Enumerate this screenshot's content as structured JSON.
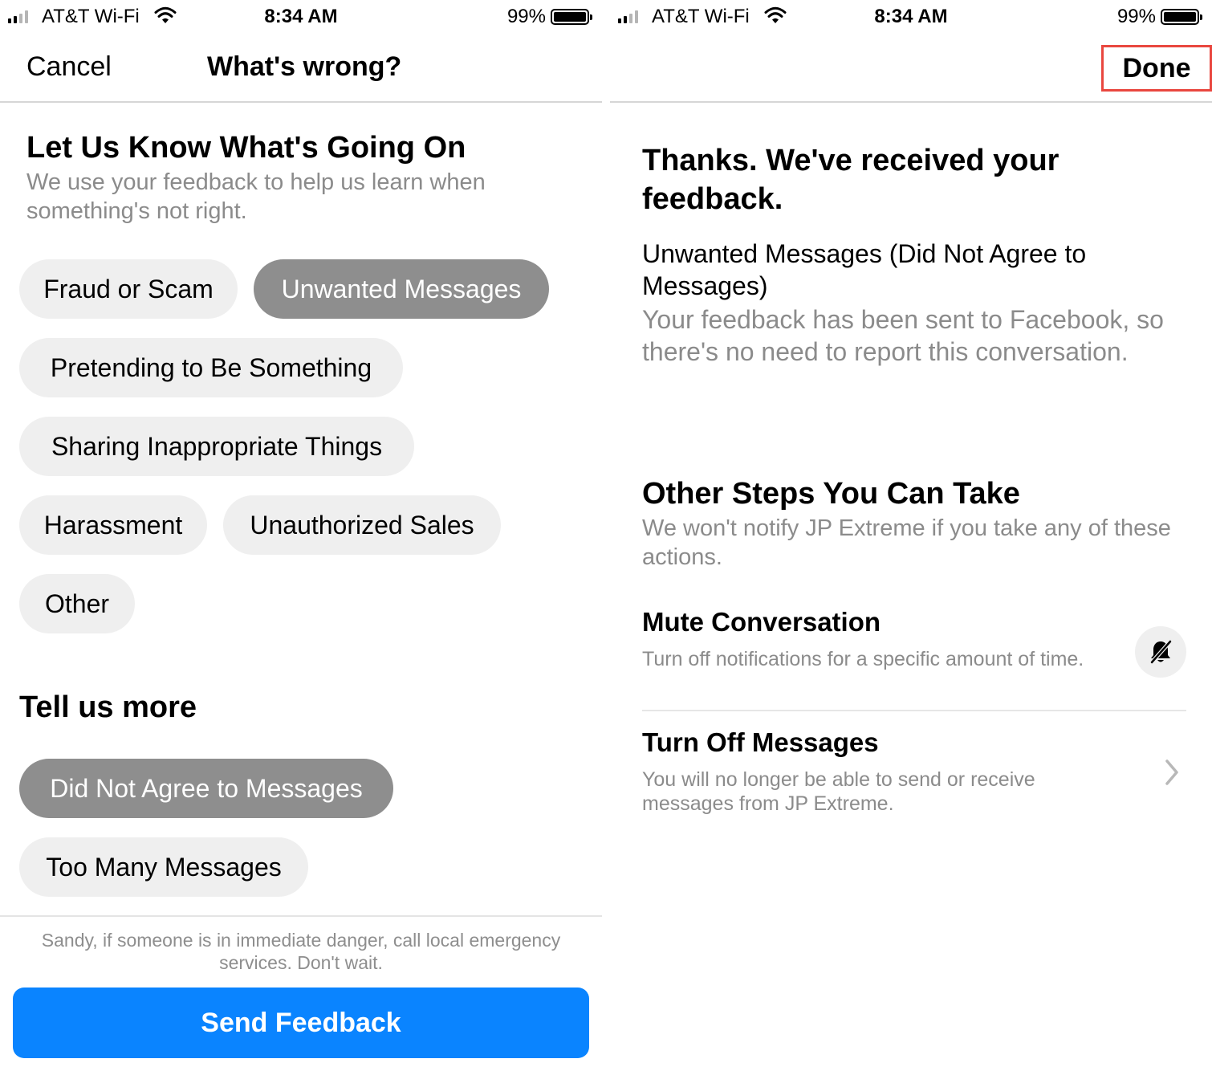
{
  "status_bar": {
    "carrier": "AT&T Wi-Fi",
    "time": "8:34 AM",
    "battery": "99%"
  },
  "left": {
    "nav": {
      "cancel_label": "Cancel",
      "title": "What's wrong?"
    },
    "heading": "Let Us Know What's Going On",
    "subheading": "We use your feedback to help us learn when something's not right.",
    "options": [
      {
        "label": "Fraud or Scam",
        "selected": false
      },
      {
        "label": "Unwanted Messages",
        "selected": true
      },
      {
        "label": "Pretending to Be Something",
        "selected": false
      },
      {
        "label": "Sharing Inappropriate Things",
        "selected": false
      },
      {
        "label": "Harassment",
        "selected": false
      },
      {
        "label": "Unauthorized Sales",
        "selected": false
      },
      {
        "label": "Other",
        "selected": false
      }
    ],
    "more_heading": "Tell us more",
    "more_options": [
      {
        "label": "Did Not Agree to Messages",
        "selected": true
      },
      {
        "label": "Too Many Messages",
        "selected": false
      }
    ],
    "danger_note": "Sandy, if someone is in immediate danger, call local emergency services. Don't wait.",
    "send_label": "Send Feedback"
  },
  "right": {
    "nav": {
      "done_label": "Done"
    },
    "title": "Thanks. We've received your feedback.",
    "reason": "Unwanted Messages (Did Not Agree to Messages)",
    "sent_note": "Your feedback has been sent to Facebook, so there's no need to report this conversation.",
    "steps_heading": "Other Steps You Can Take",
    "steps_sub": "We won't notify JP Extreme if you take any of these actions.",
    "actions": [
      {
        "title": "Mute Conversation",
        "desc": "Turn off notifications for a specific amount of time.",
        "icon": "bell-slash-icon"
      },
      {
        "title": "Turn Off Messages",
        "desc": "You will no longer be able to send or receive messages from JP Extreme.",
        "icon": "chevron-right-icon"
      }
    ]
  },
  "colors": {
    "accent": "#0a84ff",
    "selected_chip": "#8e8e8e",
    "chip": "#efefef",
    "highlight_box": "#e9473f"
  }
}
